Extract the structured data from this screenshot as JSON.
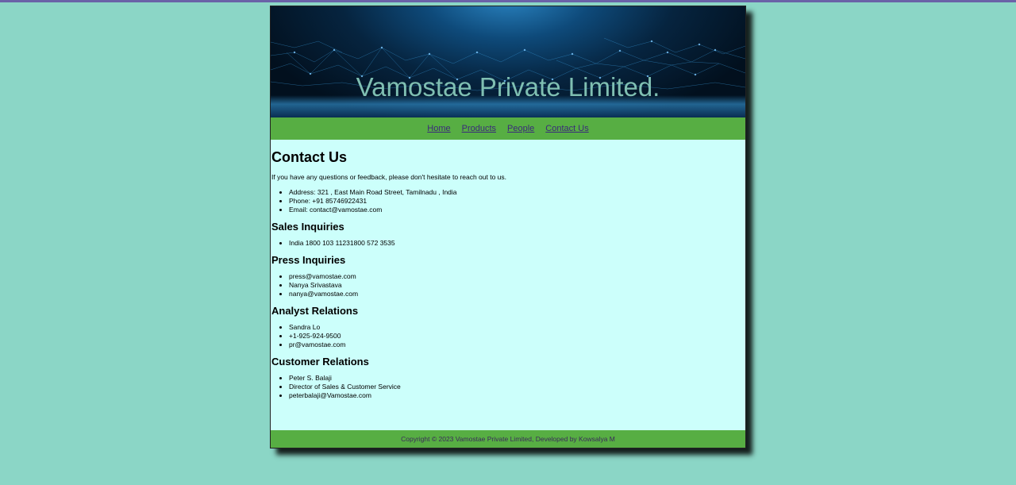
{
  "site": {
    "title": "Vamostae Private Limited."
  },
  "nav": {
    "items": [
      "Home",
      "Products",
      "People",
      "Contact Us"
    ]
  },
  "contact": {
    "heading": "Contact Us",
    "intro": "If you have any questions or feedback, please don't hesitate to reach out to us.",
    "details": [
      "Address: 321 , East Main Road Street, Tamilnadu , India",
      "Phone: +91 85746922431",
      "Email: contact@vamostae.com"
    ]
  },
  "sections": [
    {
      "heading": "Sales Inquiries",
      "items": [
        "India 1800 103 11231800 572 3535"
      ]
    },
    {
      "heading": "Press Inquiries",
      "items": [
        "press@vamostae.com",
        "Nanya Srivastava",
        "nanya@vamostae.com"
      ]
    },
    {
      "heading": "Analyst Relations",
      "items": [
        "Sandra Lo",
        "+1-925-924-9500",
        "pr@vamostae.com"
      ]
    },
    {
      "heading": "Customer Relations",
      "items": [
        "Peter S. Balaji",
        "Director of Sales & Customer Service",
        "peterbalaji@Vamostae.com"
      ]
    }
  ],
  "footer": {
    "text": "Copyright © 2023 Vamostae Private Limited, Developed by Kowsalya M"
  },
  "colors": {
    "background": "#8bd6c6",
    "nav_bar": "#57ae43",
    "content_bg": "#ccfffb",
    "link": "#3a2a7a"
  }
}
